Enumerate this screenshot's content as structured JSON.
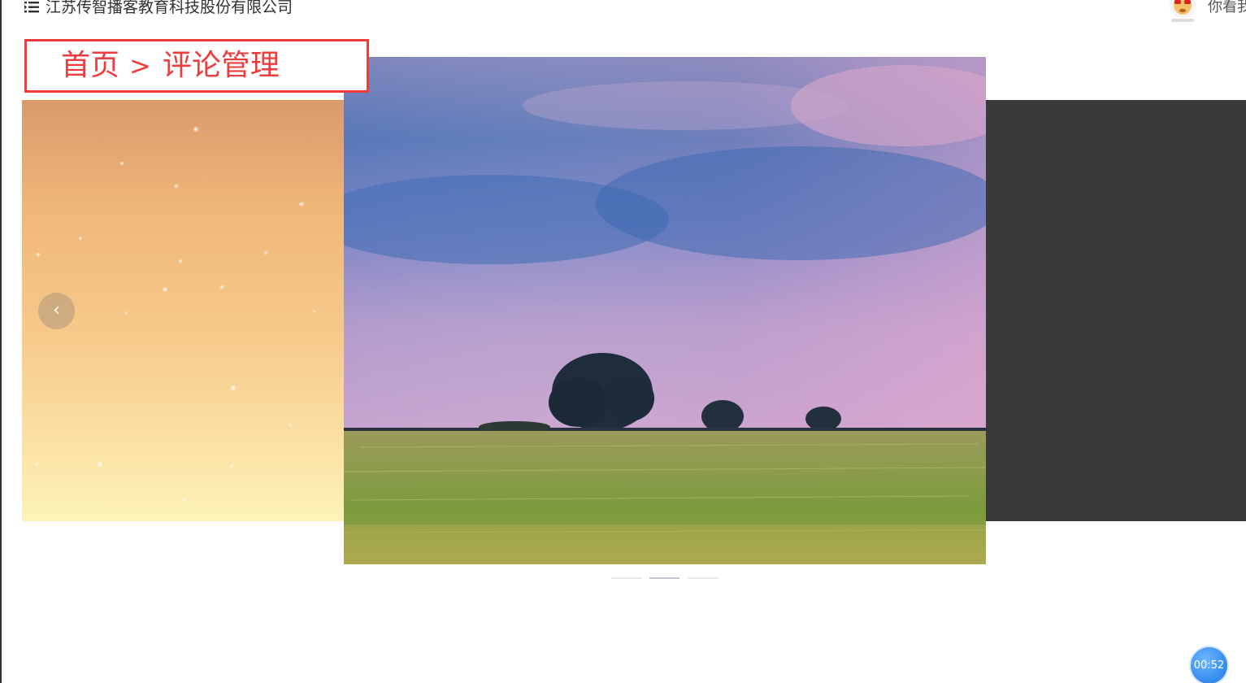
{
  "header": {
    "company_name": "江苏传智播客教育科技股份有限公司",
    "greeting": "你看我",
    "menu_icon": "hamburger-menu-icon",
    "avatar_icon": "user-avatar-icon"
  },
  "breadcrumb": {
    "home": "首页",
    "separator": ">",
    "current": "评论管理",
    "highlight_color": "#ee3b3b"
  },
  "carousel": {
    "slides": [
      {
        "name": "warm-sunset-sky",
        "state": "previous"
      },
      {
        "name": "grass-field-tree",
        "state": "active"
      },
      {
        "name": "dark-slide",
        "state": "next"
      }
    ],
    "indicator_count": 3,
    "active_index": 1,
    "prev_arrow_glyph": "‹"
  },
  "timer": {
    "value": "00:52",
    "color": "#3a8ff0"
  }
}
